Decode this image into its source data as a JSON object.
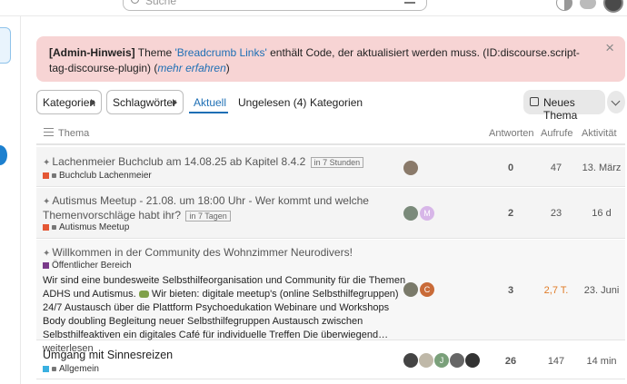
{
  "header": {
    "search_placeholder": "Suche"
  },
  "notice": {
    "prefix": "[Admin-Hinweis]",
    "text1": " Theme ",
    "theme_link": "'Breadcrumb Links'",
    "text2": " enthält Code, der aktualisiert werden muss. (ID:discourse.script-tag-discourse-plugin) (",
    "more_link": "mehr erfahren",
    "text3": ")",
    "close": "×"
  },
  "nav": {
    "categories_dropdown": "Kategorien",
    "tags_dropdown": "Schlagwörter",
    "tabs": [
      "Aktuell",
      "Ungelesen (4)",
      "Kategorien"
    ],
    "new_topic": "Neues Thema"
  },
  "table": {
    "headers": {
      "topic": "Thema",
      "replies": "Antworten",
      "views": "Aufrufe",
      "activity": "Aktivität"
    },
    "rows": [
      {
        "title": "Lachenmeier Buchclub am 14.08.25 ab Kapitel 8.4.2",
        "badge": "in 7 Stunden",
        "category": "Buchclub Lachenmeier",
        "replies": "0",
        "views": "47",
        "activity": "13. März"
      },
      {
        "title_line1": "Autismus Meetup - 21.08. um 18:00 Uhr - Wer kommt und welche",
        "title_line2": "Themenvorschläge habt ihr?",
        "badge": "in 7 Tagen",
        "category": "Autismus Meetup",
        "replies": "2",
        "views": "23",
        "activity": "16 d",
        "avatar_letter": "M"
      },
      {
        "title": "Willkommen in der Community des Wohnzimmer Neurodivers!",
        "category": "Öffentlicher Bereich",
        "excerpt_1": "Wir sind eine bundesweite Selbsthilfeorganisation und Community für die Themen ADHS und Autismus.",
        "excerpt_2": " Wir bieten: digitale meetup's (online Selbsthilfegruppen) 24/7 Austausch über die Plattform Psychoedukation Webinare und Workshops Body doubling Begleitung neuer Selbsthilfegruppen Austausch zwischen Selbsthilfeaktiven ein digitales Café für individuelle Treffen Die überwiegend… ",
        "more": "weiterlesen",
        "replies": "3",
        "views": "2,7 T.",
        "activity": "23. Juni",
        "avatar_letter": "C"
      },
      {
        "title": "Umgang mit Sinnesreizen",
        "category": "Allgemein",
        "replies": "26",
        "views": "147",
        "activity": "14 min",
        "avatar_letter": "J"
      }
    ]
  },
  "colors": {
    "accent": "#1e6fb5",
    "notice_bg": "#f7d4d4",
    "hot_views": "#e07b27",
    "cat_buchclub": "#e45735",
    "cat_meetup": "#e45735",
    "cat_public": "#7a3a8a",
    "cat_allgemein": "#3ab0e0"
  },
  "icons": [
    "search-icon",
    "filter-icon",
    "theme-toggle-icon",
    "chat-icon",
    "pin-icon",
    "lock-icon",
    "pencil-icon",
    "chevron-down-icon",
    "list-icon",
    "close-icon"
  ]
}
